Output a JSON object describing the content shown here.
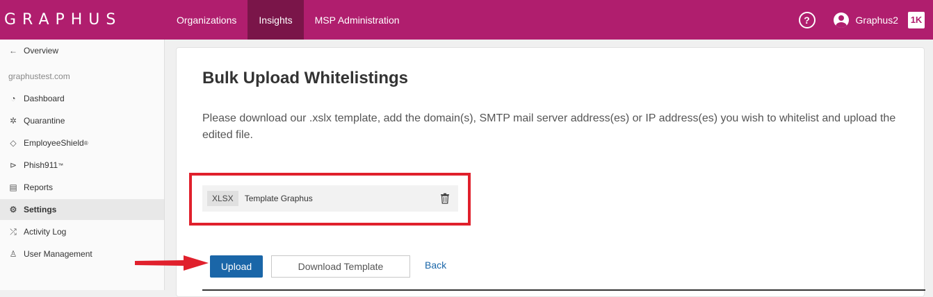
{
  "topbar": {
    "logo": "GRAPHUS",
    "nav": [
      {
        "label": "Organizations"
      },
      {
        "label": "Insights"
      },
      {
        "label": "MSP Administration"
      }
    ],
    "user_name": "Graphus2",
    "brand_badge": "1K",
    "accent": "#b01e6e"
  },
  "sidebar": {
    "back_label": "Overview",
    "org_name": "graphustest.com",
    "items": [
      {
        "label": "Dashboard",
        "icon": "gauge-icon"
      },
      {
        "label": "Quarantine",
        "icon": "virus-icon"
      },
      {
        "label": "EmployeeShield",
        "sup": "®",
        "icon": "shield-icon"
      },
      {
        "label": "Phish911",
        "sup": "™",
        "icon": "fish-icon"
      },
      {
        "label": "Reports",
        "icon": "report-icon"
      },
      {
        "label": "Settings",
        "icon": "gear-icon"
      },
      {
        "label": "Activity Log",
        "icon": "shuffle-icon"
      },
      {
        "label": "User Management",
        "icon": "user-icon"
      }
    ]
  },
  "main": {
    "title": "Bulk Upload Whitelistings",
    "description": "Please download our .xslx template, add the domain(s), SMTP mail server address(es) or IP address(es) you wish to whitelist and upload the edited file.",
    "file": {
      "type": "XLSX",
      "name": "Template Graphus"
    },
    "upload_label": "Upload",
    "download_label": "Download Template",
    "back_label": "Back"
  }
}
